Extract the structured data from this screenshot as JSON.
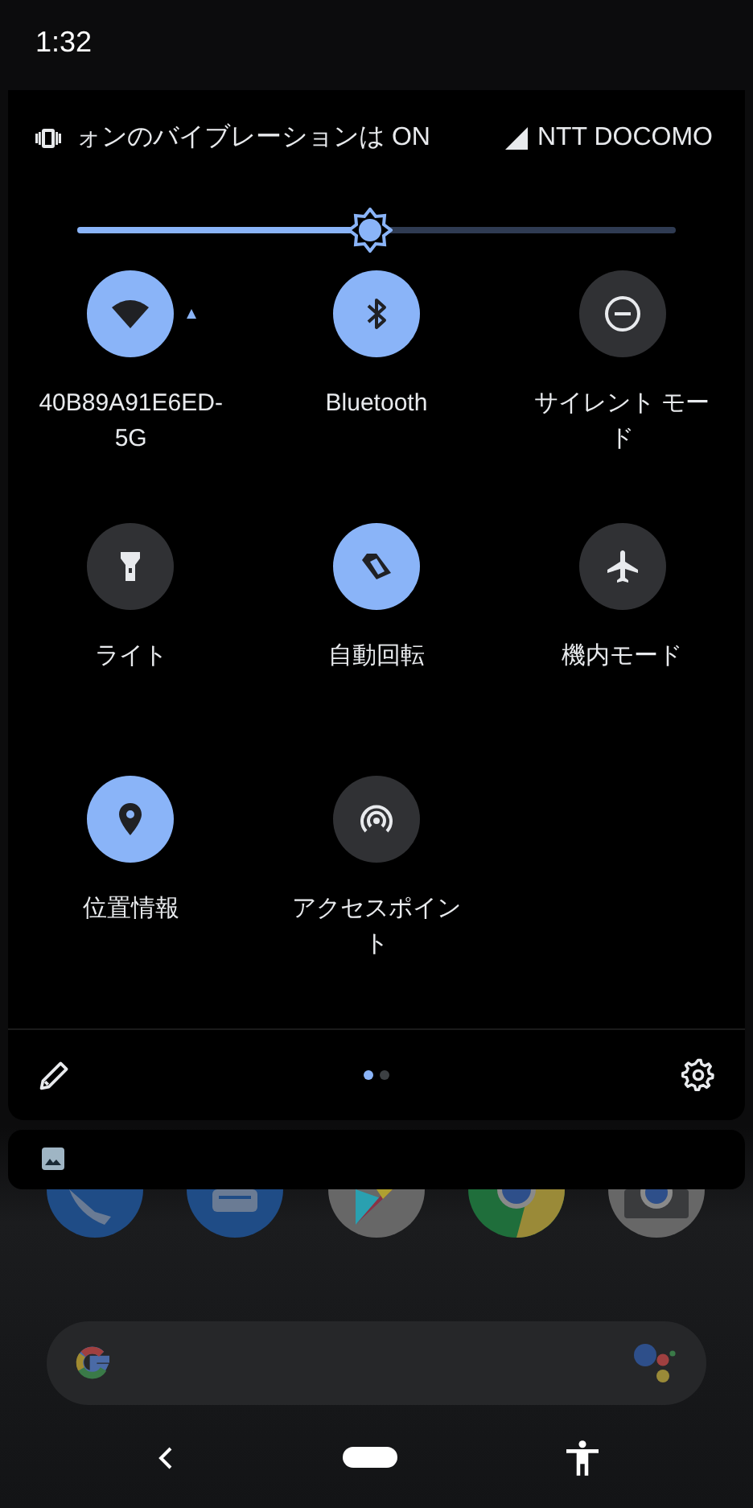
{
  "status_bar": {
    "time": "1:32"
  },
  "quick_settings": {
    "ringer_text": "ォンのバイブレーションは ON",
    "carrier": "NTT DOCOMO",
    "brightness": {
      "level": 0.49
    },
    "tiles": [
      {
        "label": "40B89A91E6ED-5G",
        "on": true
      },
      {
        "label": "Bluetooth",
        "on": true
      },
      {
        "label": "サイレント モード",
        "on": false
      },
      {
        "label": "ライト",
        "on": false
      },
      {
        "label": "自動回転",
        "on": true
      },
      {
        "label": "機内モード",
        "on": false
      },
      {
        "label": "位置情報",
        "on": true
      },
      {
        "label": "アクセスポイント",
        "on": false
      }
    ],
    "pages": [
      {
        "selected": true
      },
      {
        "selected": false
      }
    ]
  }
}
